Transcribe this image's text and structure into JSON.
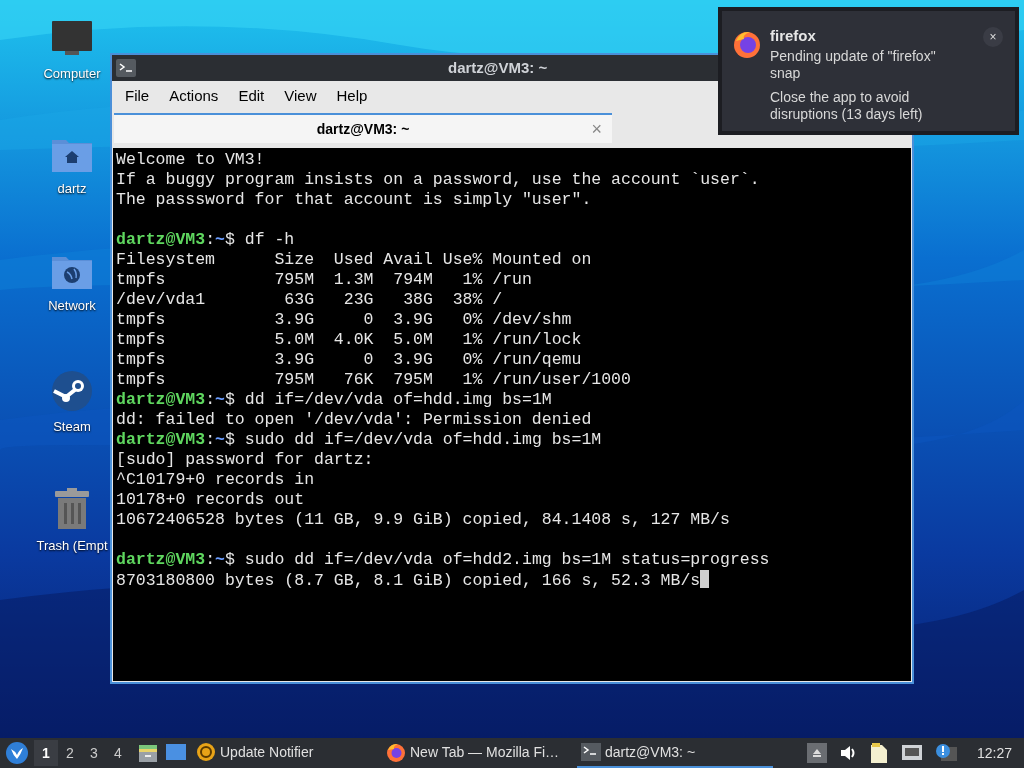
{
  "desktop_icons": [
    {
      "label": "Computer",
      "kind": "computer"
    },
    {
      "label": "dartz",
      "kind": "home"
    },
    {
      "label": "Network",
      "kind": "network"
    },
    {
      "label": "Steam",
      "kind": "steam"
    },
    {
      "label": "Trash (Empt",
      "kind": "trash"
    }
  ],
  "terminal": {
    "title": "dartz@VM3: ~",
    "menu": [
      "File",
      "Actions",
      "Edit",
      "View",
      "Help"
    ],
    "tabs": [
      {
        "label": "dartz@VM3: ~",
        "selected": true,
        "close": "×"
      }
    ],
    "lines": [
      {
        "kind": "output",
        "text": "Welcome to VM3!"
      },
      {
        "kind": "output",
        "text": "If a buggy program insists on a password, use the account `user`."
      },
      {
        "kind": "output",
        "text": "The passsword for that account is simply \"user\"."
      },
      {
        "kind": "blank"
      },
      {
        "kind": "command",
        "user": "dartz@VM3",
        "separator": ":",
        "path": "~",
        "command": "$ df -h"
      },
      {
        "kind": "output",
        "text": "Filesystem      Size  Used Avail Use% Mounted on"
      },
      {
        "kind": "output",
        "text": "tmpfs           795M  1.3M  794M   1% /run"
      },
      {
        "kind": "output",
        "text": "/dev/vda1        63G   23G   38G  38% /"
      },
      {
        "kind": "output",
        "text": "tmpfs           3.9G     0  3.9G   0% /dev/shm"
      },
      {
        "kind": "output",
        "text": "tmpfs           5.0M  4.0K  5.0M   1% /run/lock"
      },
      {
        "kind": "output",
        "text": "tmpfs           3.9G     0  3.9G   0% /run/qemu"
      },
      {
        "kind": "output",
        "text": "tmpfs           795M   76K  795M   1% /run/user/1000"
      },
      {
        "kind": "command",
        "user": "dartz@VM3",
        "separator": ":",
        "path": "~",
        "command": "$ dd if=/dev/vda of=hdd.img bs=1M"
      },
      {
        "kind": "output",
        "text": "dd: failed to open '/dev/vda': Permission denied"
      },
      {
        "kind": "command",
        "user": "dartz@VM3",
        "separator": ":",
        "path": "~",
        "command": "$ sudo dd if=/dev/vda of=hdd.img bs=1M"
      },
      {
        "kind": "output",
        "text": "[sudo] password for dartz:"
      },
      {
        "kind": "output",
        "text": "^C10179+0 records in"
      },
      {
        "kind": "output",
        "text": "10178+0 records out"
      },
      {
        "kind": "output",
        "text": "10672406528 bytes (11 GB, 9.9 GiB) copied, 84.1408 s, 127 MB/s"
      },
      {
        "kind": "blank"
      },
      {
        "kind": "command",
        "user": "dartz@VM3",
        "separator": ":",
        "path": "~",
        "command": "$ sudo dd if=/dev/vda of=hdd2.img bs=1M status=progress"
      },
      {
        "kind": "output",
        "text": "8703180800 bytes (8.7 GB, 8.1 GiB) copied, 166 s, 52.3 MB/s",
        "cursor": true
      }
    ]
  },
  "notification": {
    "app": "firefox",
    "body_1": "Pending update of \"firefox\" snap",
    "body_2": "Close the app to avoid disruptions (13 days left)",
    "close": "×"
  },
  "taskbar": {
    "workspaces": [
      {
        "label": "1",
        "selected": true
      },
      {
        "label": "2",
        "selected": false
      },
      {
        "label": "3",
        "selected": false
      },
      {
        "label": "4",
        "selected": false
      }
    ],
    "tasks": [
      {
        "label": "Update Notifier",
        "kind": "updater",
        "selected": false
      },
      {
        "label": "New Tab — Mozilla Fi…",
        "kind": "firefox",
        "selected": false
      },
      {
        "label": "dartz@VM3: ~",
        "kind": "terminal",
        "selected": true
      }
    ],
    "clock": "12:27"
  }
}
